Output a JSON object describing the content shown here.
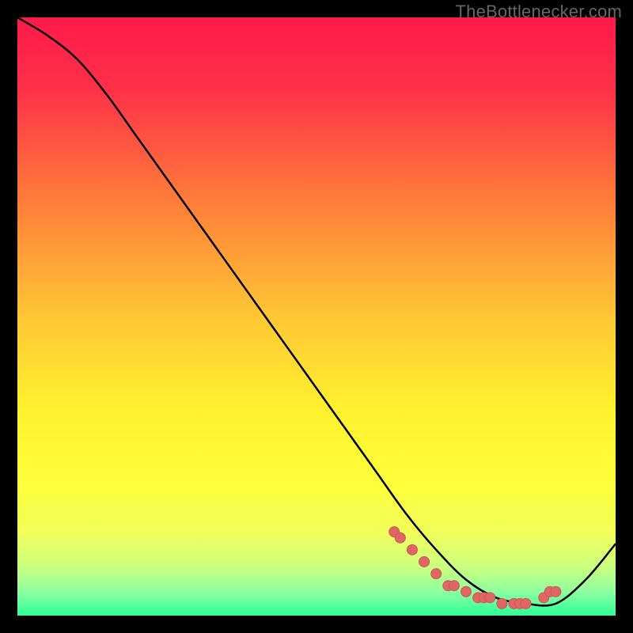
{
  "attribution": "TheBottlenecker.com",
  "chart_data": {
    "type": "line",
    "title": "",
    "xlabel": "",
    "ylabel": "",
    "xlim": [
      0,
      100
    ],
    "ylim": [
      0,
      100
    ],
    "grid": false,
    "legend": false,
    "series": [
      {
        "name": "curve",
        "x": [
          0,
          5,
          10,
          15,
          20,
          25,
          30,
          35,
          40,
          45,
          50,
          55,
          60,
          65,
          70,
          75,
          80,
          85,
          90,
          95,
          100
        ],
        "y": [
          100,
          97,
          93,
          87,
          80,
          73,
          66,
          59,
          52,
          45,
          38,
          31,
          24,
          17,
          11,
          6,
          3,
          2,
          2,
          6,
          12
        ]
      }
    ],
    "markers": {
      "name": "dots",
      "x": [
        63,
        64,
        66,
        68,
        70,
        72,
        73,
        75,
        77,
        78,
        79,
        81,
        83,
        84,
        85,
        88,
        89,
        90
      ],
      "y": [
        14,
        13,
        11,
        9,
        7,
        5,
        5,
        4,
        3,
        3,
        3,
        2,
        2,
        2,
        2,
        3,
        4,
        4
      ]
    },
    "background_gradient": {
      "stops": [
        {
          "offset": 0.0,
          "color": "#ff1a4b"
        },
        {
          "offset": 0.12,
          "color": "#ff3049"
        },
        {
          "offset": 0.3,
          "color": "#ff7a3a"
        },
        {
          "offset": 0.5,
          "color": "#ffc634"
        },
        {
          "offset": 0.65,
          "color": "#fff02e"
        },
        {
          "offset": 0.78,
          "color": "#fdff3a"
        },
        {
          "offset": 0.86,
          "color": "#f2ff5a"
        },
        {
          "offset": 0.92,
          "color": "#c9ff80"
        },
        {
          "offset": 0.96,
          "color": "#8effa0"
        },
        {
          "offset": 1.0,
          "color": "#2eff9a"
        }
      ]
    },
    "colors": {
      "line": "#000000",
      "marker_fill": "#e06666",
      "marker_stroke": "#cc5555"
    }
  }
}
